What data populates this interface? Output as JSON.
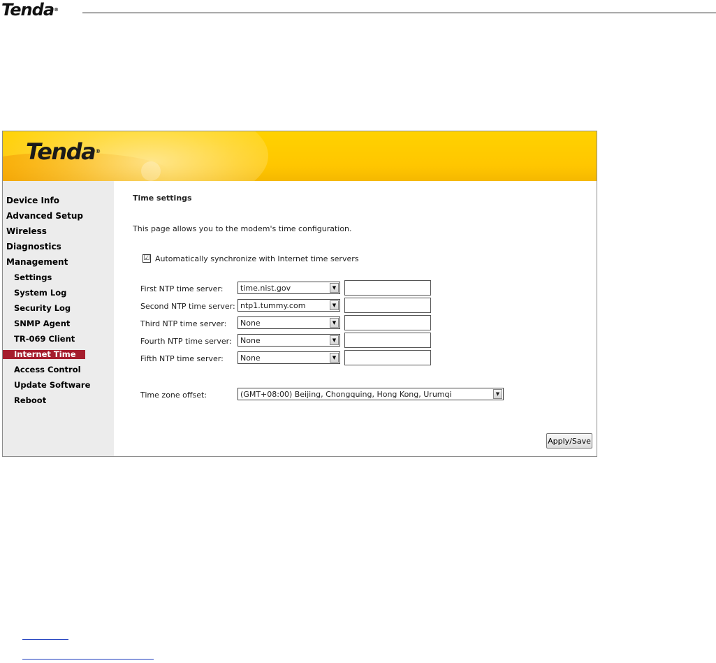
{
  "doc_header": {
    "logo_text": "Tenda",
    "logo_mark": "®"
  },
  "banner": {
    "logo_text": "Tenda",
    "logo_mark": "®"
  },
  "sidebar": {
    "items": [
      {
        "label": "Device Info",
        "level": 0
      },
      {
        "label": "Advanced Setup",
        "level": 0
      },
      {
        "label": "Wireless",
        "level": 0
      },
      {
        "label": "Diagnostics",
        "level": 0
      },
      {
        "label": "Management",
        "level": 0
      },
      {
        "label": "Settings",
        "level": 1
      },
      {
        "label": "System Log",
        "level": 1
      },
      {
        "label": "Security Log",
        "level": 1
      },
      {
        "label": "SNMP Agent",
        "level": 1
      },
      {
        "label": "TR-069 Client",
        "level": 1
      },
      {
        "label": "Internet Time",
        "level": 1,
        "active": true
      },
      {
        "label": "Access Control",
        "level": 1
      },
      {
        "label": "Update Software",
        "level": 1
      },
      {
        "label": "Reboot",
        "level": 1
      }
    ],
    "active_color": "#a51d2d"
  },
  "content": {
    "title": "Time settings",
    "description": "This page allows you to the modem's time configuration.",
    "auto_sync": {
      "label": "Automatically synchronize with Internet time servers",
      "checked": true,
      "mark": "☑"
    },
    "ntp_servers": [
      {
        "label": "First NTP time server:",
        "selected": "time.nist.gov",
        "custom": ""
      },
      {
        "label": "Second NTP time server:",
        "selected": "ntp1.tummy.com",
        "custom": ""
      },
      {
        "label": "Third NTP time server:",
        "selected": "None",
        "custom": ""
      },
      {
        "label": "Fourth NTP time server:",
        "selected": "None",
        "custom": ""
      },
      {
        "label": "Fifth NTP time server:",
        "selected": "None",
        "custom": ""
      }
    ],
    "timezone": {
      "label": "Time zone offset:",
      "selected": "(GMT+08:00) Beijing, Chongquing, Hong Kong, Urumqi"
    },
    "apply_label": "Apply/Save",
    "dropdown_arrow": "▼"
  },
  "colors": {
    "banner_yellow": "#ffc600",
    "sidebar_bg": "#ececec",
    "link_blue": "#1f3fbf"
  }
}
